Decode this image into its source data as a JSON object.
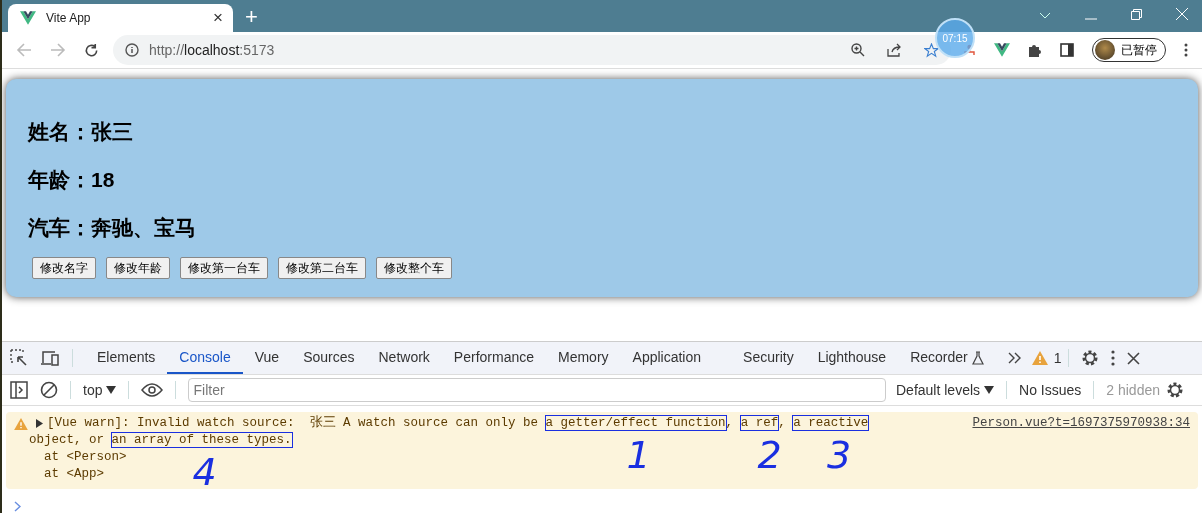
{
  "browser": {
    "tab": {
      "title": "Vite App",
      "close": "×"
    },
    "new_tab": "+",
    "url": {
      "scheme": "http://",
      "host": "localhost",
      "port": ":5173"
    },
    "profile": "已暂停",
    "timer_overlay": "07:15"
  },
  "page": {
    "fields": [
      {
        "label": "姓名：",
        "value": "张三"
      },
      {
        "label": "年龄：",
        "value": "18"
      },
      {
        "label": "汽车：",
        "value": "奔驰、宝马"
      }
    ],
    "buttons": [
      "修改名字",
      "修改年龄",
      "修改第一台车",
      "修改第二台车",
      "修改整个车"
    ]
  },
  "devtools": {
    "tabs": [
      {
        "label": "Elements",
        "selected": false
      },
      {
        "label": "Console",
        "selected": true
      },
      {
        "label": "Vue",
        "selected": false
      },
      {
        "label": "Sources",
        "selected": false
      },
      {
        "label": "Network",
        "selected": false
      },
      {
        "label": "Performance",
        "selected": false
      },
      {
        "label": "Memory",
        "selected": false
      },
      {
        "label": "Application",
        "selected": false
      },
      {
        "label": "Security",
        "selected": false
      },
      {
        "label": "Lighthouse",
        "selected": false
      },
      {
        "label": "Recorder",
        "selected": false
      }
    ],
    "issue_count": "1",
    "toolbar": {
      "context": "top",
      "filter_placeholder": "Filter",
      "levels": "Default levels",
      "issues": "No Issues",
      "hidden": "2 hidden"
    },
    "message": {
      "source": "Person.vue?t=1697375970938:34",
      "lines": [
        [
          {
            "text": "[Vue warn]: Invalid watch source:  张三 A watch source can only be ",
            "boxed": false
          },
          {
            "text": "a getter/effect function",
            "boxed": true,
            "note": "1"
          },
          {
            "text": ", ",
            "boxed": false
          },
          {
            "text": "a ref",
            "boxed": true,
            "note": "2"
          },
          {
            "text": ", ",
            "boxed": false
          },
          {
            "text": "a reactive",
            "boxed": true,
            "note": "3"
          }
        ],
        [
          {
            "text": "object, or ",
            "boxed": false
          },
          {
            "text": "an array of these types.",
            "boxed": true,
            "note": "4"
          }
        ],
        [
          {
            "text": "  at <Person>",
            "boxed": false
          }
        ],
        [
          {
            "text": "  at <App>",
            "boxed": false
          }
        ]
      ]
    }
  }
}
